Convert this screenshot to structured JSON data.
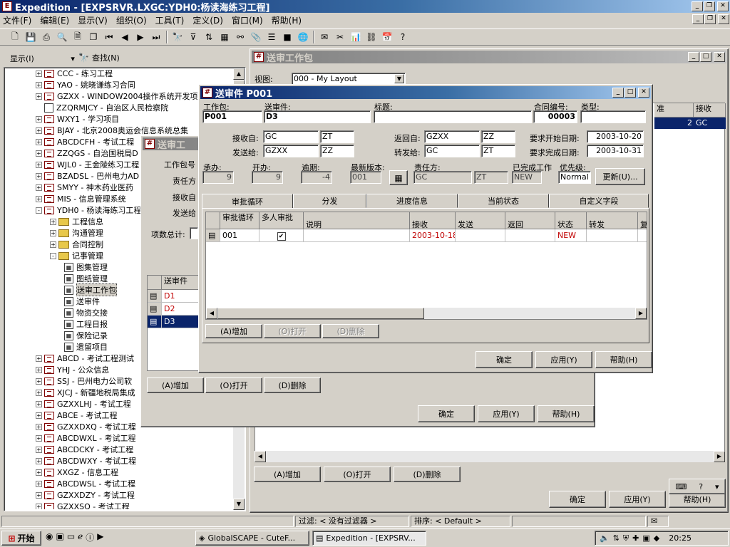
{
  "app": {
    "title": "Expedition - [EXPSRVR.LXGC:YDH0:杨读海练习工程]"
  },
  "menu": [
    "文件(F)",
    "编辑(E)",
    "显示(V)",
    "组织(O)",
    "工具(T)",
    "定义(D)",
    "窗口(M)",
    "帮助(H)"
  ],
  "left": {
    "show_label": "显示(I)",
    "find_label": "查找(N)"
  },
  "tree": [
    {
      "label": "CCC - 练习工程",
      "type": "node",
      "level": 0,
      "exp": "+"
    },
    {
      "label": "YAO - 姚晓谦练习合同",
      "type": "node",
      "level": 0,
      "exp": "+"
    },
    {
      "label": "GZXX - WINDOW2004操作系统开发项",
      "type": "node",
      "level": 0,
      "exp": "+"
    },
    {
      "label": "ZZQRMJCY - 自治区人民检察院",
      "type": "plain",
      "level": 0,
      "exp": ""
    },
    {
      "label": "WXY1 - 学习项目",
      "type": "node",
      "level": 0,
      "exp": "+"
    },
    {
      "label": "BJAY - 北京2008奥运会信息系统总集",
      "type": "node",
      "level": 0,
      "exp": "+"
    },
    {
      "label": "ABCDCFH - 考试工程",
      "type": "node",
      "level": 0,
      "exp": "+"
    },
    {
      "label": "ZZQGS - 自治国税局D",
      "type": "node",
      "level": 0,
      "exp": "+"
    },
    {
      "label": "WJL0 - 王金陵练习工程",
      "type": "node",
      "level": 0,
      "exp": "+"
    },
    {
      "label": "BZADSL - 巴州电力AD",
      "type": "node",
      "level": 0,
      "exp": "+"
    },
    {
      "label": "SMYY - 神木药业医药",
      "type": "node",
      "level": 0,
      "exp": "+"
    },
    {
      "label": "MIS - 信息管理系统",
      "type": "node",
      "level": 0,
      "exp": "+"
    },
    {
      "label": "YDH0 - 杨读海练习工程",
      "type": "node",
      "level": 0,
      "exp": "-"
    },
    {
      "label": "工程信息",
      "type": "folder",
      "level": 1,
      "exp": "+"
    },
    {
      "label": "沟通管理",
      "type": "folder",
      "level": 1,
      "exp": "+"
    },
    {
      "label": "合同控制",
      "type": "folder",
      "level": 1,
      "exp": "+"
    },
    {
      "label": "记事管理",
      "type": "folder",
      "level": 1,
      "exp": "-"
    },
    {
      "label": "图集管理",
      "type": "grid",
      "level": 2,
      "exp": ""
    },
    {
      "label": "图纸管理",
      "type": "grid",
      "level": 2,
      "exp": ""
    },
    {
      "label": "送审工作包",
      "type": "grid",
      "level": 2,
      "exp": "",
      "selected": true
    },
    {
      "label": "送审件",
      "type": "grid",
      "level": 2,
      "exp": ""
    },
    {
      "label": "物资交接",
      "type": "grid",
      "level": 2,
      "exp": ""
    },
    {
      "label": "工程日报",
      "type": "grid",
      "level": 2,
      "exp": ""
    },
    {
      "label": "保险记录",
      "type": "grid",
      "level": 2,
      "exp": ""
    },
    {
      "label": "遗留项目",
      "type": "grid",
      "level": 2,
      "exp": ""
    },
    {
      "label": "ABCD - 考试工程测试",
      "type": "node",
      "level": 0,
      "exp": "+"
    },
    {
      "label": "YHJ - 公众信息",
      "type": "node",
      "level": 0,
      "exp": "+"
    },
    {
      "label": "SSJ - 巴州电力公司软",
      "type": "node",
      "level": 0,
      "exp": "+"
    },
    {
      "label": "XJCJ - 新疆地税局集成",
      "type": "node",
      "level": 0,
      "exp": "+"
    },
    {
      "label": "GZXXLHJ - 考试工程",
      "type": "node",
      "level": 0,
      "exp": "+"
    },
    {
      "label": "ABCE - 考试工程",
      "type": "node",
      "level": 0,
      "exp": "+"
    },
    {
      "label": "GZXXDXQ - 考试工程",
      "type": "node",
      "level": 0,
      "exp": "+"
    },
    {
      "label": "ABCDWXL - 考试工程",
      "type": "node",
      "level": 0,
      "exp": "+"
    },
    {
      "label": "ABCDCKY - 考试工程",
      "type": "node",
      "level": 0,
      "exp": "+"
    },
    {
      "label": "ABCDWXY - 考试工程",
      "type": "node",
      "level": 0,
      "exp": "+"
    },
    {
      "label": "XXGZ - 信息工程",
      "type": "node",
      "level": 0,
      "exp": "+"
    },
    {
      "label": "ABCDWSL - 考试工程",
      "type": "node",
      "level": 0,
      "exp": "+"
    },
    {
      "label": "GZXXDZY - 考试工程",
      "type": "node",
      "level": 0,
      "exp": "+"
    },
    {
      "label": "GZXXSQ - 考试工程",
      "type": "node",
      "level": 0,
      "exp": "+"
    }
  ],
  "bg": {
    "title": "送审工作包",
    "view_label": "视图:",
    "view_value": "000 - My Layout",
    "col_partial": "准",
    "col_receive": "接收",
    "row_partial": "2",
    "row_receive": "GC",
    "btn_add": "(A)增加",
    "btn_open": "(O)打开",
    "btn_delete": "(D)删除",
    "btn_ok": "确定",
    "btn_apply": "应用(Y)",
    "btn_help": "帮助(H)"
  },
  "mid": {
    "title": "送审工",
    "lbl_pkg": "工作包号",
    "lbl_resp": "责任方",
    "lbl_recv": "接收自",
    "lbl_send": "发送给",
    "lbl_total": "项数总计:",
    "col": "送审件",
    "rows": [
      "D1",
      "D2",
      "D3"
    ],
    "btn_add": "(A)增加",
    "btn_open": "(O)打开",
    "btn_delete": "(D)删除",
    "btn_ok": "确定",
    "btn_apply": "应用(Y)",
    "btn_help": "帮助(H)"
  },
  "dlg": {
    "title": "送审件  P001",
    "lbl_package": "工作包:",
    "package": "P001",
    "lbl_doc": "送审件:",
    "doc": "D3",
    "lbl_subject": "标题:",
    "subject": "",
    "lbl_contract": "合同编号:",
    "contract": "00003",
    "lbl_type": "类型:",
    "type": "",
    "lbl_recv_from": "接收自:",
    "recv_from": "GC",
    "recv_from2": "ZT",
    "lbl_send_to": "发送给:",
    "send_to": "GZXX",
    "send_to2": "ZZ",
    "lbl_return_from": "返回自:",
    "return_from": "GZXX",
    "return_from2": "ZZ",
    "lbl_forward_to": "转发给:",
    "forward_to": "GC",
    "forward_to2": "ZT",
    "lbl_req_start": "要求开始日期:",
    "req_start": "2003-10-20",
    "lbl_req_finish": "要求完成日期:",
    "req_finish": "2003-10-31",
    "lbl_undertake": "承办:",
    "undertake": "9",
    "lbl_handle": "开办:",
    "handle": "9",
    "lbl_overdue": "逾期:",
    "overdue": "-4",
    "lbl_latest": "最新版本:",
    "latest": "001",
    "lbl_resp": "责任方:",
    "resp": "GC",
    "resp2": "ZT",
    "lbl_done": "已完成工作",
    "done": "NEW",
    "lbl_priority": "优先级:",
    "priority": "Normal",
    "btn_update": "更新(U)...",
    "tabs": [
      "审批循环",
      "分发",
      "进度信息",
      "当前状态",
      "自定义字段"
    ],
    "grid_headers": [
      "审批循环",
      "多人审批",
      "说明",
      "接收",
      "发送",
      "返回",
      "状态",
      "转发",
      "复"
    ],
    "grid_row": {
      "cycle": "001",
      "multi": "✔",
      "desc": "",
      "receive": "2003-10-18",
      "send": "",
      "return": "",
      "status": "NEW",
      "forward": "",
      "extra": ""
    },
    "btn_add": "(A)增加",
    "btn_open": "(O)打开",
    "btn_delete": "(D)删除",
    "btn_ok": "确定",
    "btn_apply": "应用(Y)",
    "btn_help": "帮助(H)"
  },
  "status": {
    "filter": "过滤: < 没有过滤器 >",
    "sort": "排序: < Default >"
  },
  "taskbar": {
    "start": "开始",
    "tasks": [
      "GlobalSCAPE - CuteF...",
      "Expedition - [EXPSRV..."
    ],
    "clock": "20:25"
  },
  "colors": {
    "title_active": "#0a246a",
    "face": "#d4d0c8",
    "selected": "#0a246a",
    "red_text": "#c00000"
  }
}
